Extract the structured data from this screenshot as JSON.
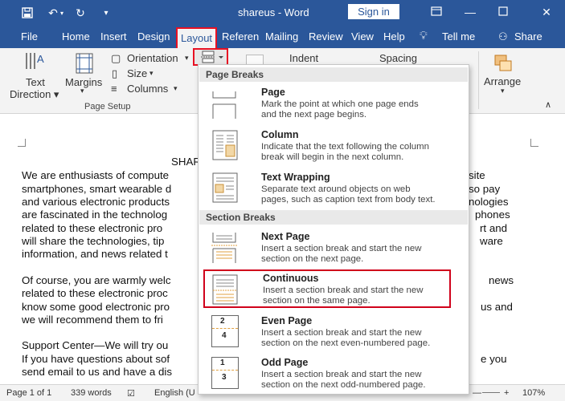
{
  "window": {
    "title": "shareus  -  Word",
    "signin_label": "Sign in"
  },
  "tabs": [
    {
      "label": "File"
    },
    {
      "label": "Home"
    },
    {
      "label": "Insert"
    },
    {
      "label": "Design"
    },
    {
      "label": "Layout"
    },
    {
      "label": "Referen"
    },
    {
      "label": "Mailing"
    },
    {
      "label": "Review"
    },
    {
      "label": "View"
    },
    {
      "label": "Help"
    },
    {
      "label": "Tell me"
    },
    {
      "label": "Share"
    }
  ],
  "ribbon": {
    "text_direction": "Text\nDirection",
    "margins": "Margins",
    "orientation": "Orientation",
    "size": "Size",
    "columns": "Columns",
    "group_label": "Page Setup",
    "indent": "Indent",
    "spacing": "Spacing",
    "arrange": "Arrange"
  },
  "document": {
    "lines": [
      "SHAR",
      "We are enthusiasts of compute",
      "smartphones, smart wearable d",
      "and various electronic products",
      "are fascinated in the technolog",
      "related to these electronic pro",
      "will share the technologies, tip",
      "information, and news related t",
      "Of course, you are warmly welc",
      "related to these electronic proc",
      "know some good electronic pro",
      "we will recommend them to fri",
      "Support Center—We will try ou",
      "If you have questions about sof",
      "send email to us and have a dis"
    ],
    "right_lines": [
      "site",
      "so pay",
      "nologies",
      "phones",
      "rt and",
      "ware",
      "news",
      "us and",
      "e you"
    ]
  },
  "dropdown": {
    "page_breaks_header": "Page Breaks",
    "section_breaks_header": "Section Breaks",
    "items": [
      {
        "name": "Page",
        "desc1": "Mark the point at which one page ends",
        "desc2": "and the next page begins."
      },
      {
        "name": "Column",
        "desc1": "Indicate that the text following the column",
        "desc2": "break will begin in the next column."
      },
      {
        "name": "Text Wrapping",
        "desc1": "Separate text around objects on web",
        "desc2": "pages, such as caption text from body text."
      },
      {
        "name": "Next Page",
        "desc1": "Insert a section break and start the new",
        "desc2": "section on the next page."
      },
      {
        "name": "Continuous",
        "desc1": "Insert a section break and start the new",
        "desc2": "section on the same page."
      },
      {
        "name": "Even Page",
        "desc1": "Insert a section break and start the new",
        "desc2": "section on the next even-numbered page."
      },
      {
        "name": "Odd Page",
        "desc1": "Insert a section break and start the new",
        "desc2": "section on the next odd-numbered page."
      }
    ],
    "even_icon_numbers": [
      "2",
      "4"
    ],
    "odd_icon_numbers": [
      "1",
      "3"
    ]
  },
  "status": {
    "page": "Page 1 of 1",
    "words": "339 words",
    "language": "English (U",
    "zoom": "107%"
  },
  "colors": {
    "title_bar": "#2b579a",
    "highlight": "#e81123"
  }
}
